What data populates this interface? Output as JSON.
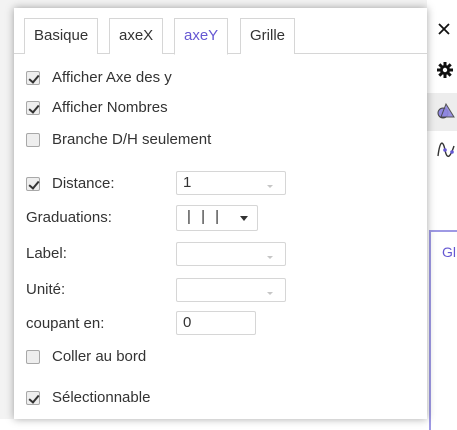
{
  "tabs": [
    {
      "label": "Basique",
      "active": false
    },
    {
      "label": "axeX",
      "active": false
    },
    {
      "label": "axeY",
      "active": true
    },
    {
      "label": "Grille",
      "active": false
    }
  ],
  "options": {
    "show_axis": {
      "label": "Afficher Axe des y",
      "checked": true
    },
    "show_numbers": {
      "label": "Afficher Nombres",
      "checked": true
    },
    "positive_only": {
      "label": "Branche D/H seulement",
      "checked": false
    },
    "distance": {
      "label": "Distance:",
      "checked": true,
      "value": "1"
    },
    "tick_style": {
      "label": "Graduations:",
      "value": "| | |"
    },
    "axis_label": {
      "label": "Label:",
      "value": ""
    },
    "unit": {
      "label": "Unité:",
      "value": ""
    },
    "crossing": {
      "label": "coupant en:",
      "value": "0"
    },
    "stick_to_edge": {
      "label": "Coller au bord",
      "checked": false
    },
    "selectable": {
      "label": "Sélectionnable",
      "checked": true
    }
  },
  "graphics_panel": {
    "label": "Gl"
  },
  "toolbar_icons": [
    "close-icon",
    "gear-icon",
    "shapes-icon",
    "curve-icon"
  ],
  "colors": {
    "accent": "#6557d2",
    "panel_border": "#9e99e4"
  }
}
